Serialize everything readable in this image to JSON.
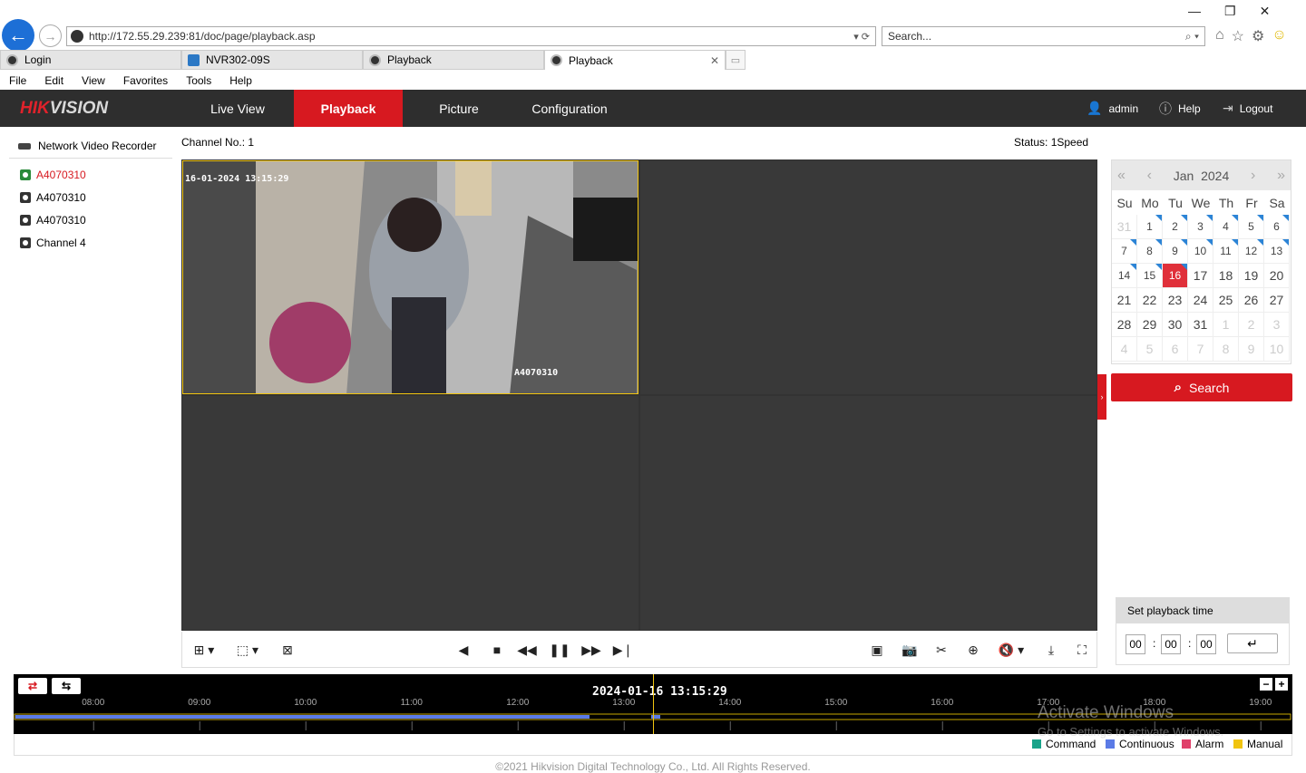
{
  "browser": {
    "url": "http://172.55.29.239:81/doc/page/playback.asp",
    "search_placeholder": "Search...",
    "tabs": [
      {
        "label": "Login"
      },
      {
        "label": "NVR302-09S"
      },
      {
        "label": "Playback"
      },
      {
        "label": "Playback"
      }
    ],
    "menu": [
      "File",
      "Edit",
      "View",
      "Favorites",
      "Tools",
      "Help"
    ]
  },
  "app": {
    "logo_a": "HIK",
    "logo_b": "VISION",
    "nav": [
      "Live View",
      "Playback",
      "Picture",
      "Configuration"
    ],
    "active_nav": "Playback",
    "user": "admin",
    "help": "Help",
    "logout": "Logout",
    "colors": {
      "brand": "#d71920",
      "header": "#2e2e2e"
    }
  },
  "left_panel": {
    "title": "Network Video Recorder",
    "channels": [
      {
        "label": "A4070310",
        "active": true
      },
      {
        "label": "A4070310",
        "active": false
      },
      {
        "label": "A4070310",
        "active": false
      },
      {
        "label": "Channel 4",
        "active": false
      }
    ]
  },
  "playback": {
    "channel_label": "Channel No.: 1",
    "status_label": "Status: 1Speed",
    "osd_time": "16-01-2024 13:15:29",
    "osd_name": "A4070310"
  },
  "calendar": {
    "month": "Jan",
    "year": "2024",
    "dow": [
      "Su",
      "Mo",
      "Tu",
      "We",
      "Th",
      "Fr",
      "Sa"
    ],
    "weeks": [
      [
        "31",
        "1",
        "2",
        "3",
        "4",
        "5",
        "6"
      ],
      [
        "7",
        "8",
        "9",
        "10",
        "11",
        "12",
        "13"
      ],
      [
        "14",
        "15",
        "16",
        "17",
        "18",
        "19",
        "20"
      ],
      [
        "21",
        "22",
        "23",
        "24",
        "25",
        "26",
        "27"
      ],
      [
        "28",
        "29",
        "30",
        "31",
        "1",
        "2",
        "3"
      ],
      [
        "4",
        "5",
        "6",
        "7",
        "8",
        "9",
        "10"
      ]
    ],
    "selected": "16"
  },
  "search_label": "Search",
  "set_time": {
    "title": "Set playback time",
    "hh": "00",
    "mm": "00",
    "ss": "00"
  },
  "timeline": {
    "current": "2024-01-16 13:15:29",
    "ticks": [
      "08:00",
      "09:00",
      "10:00",
      "11:00",
      "12:00",
      "13:00",
      "14:00",
      "15:00",
      "16:00",
      "17:00",
      "18:00",
      "19:00"
    ],
    "record_range": [
      "08:00",
      "13:15"
    ]
  },
  "legend": [
    {
      "label": "Command",
      "color": "#1aa38a"
    },
    {
      "label": "Continuous",
      "color": "#5b7be6"
    },
    {
      "label": "Alarm",
      "color": "#e0406a"
    },
    {
      "label": "Manual",
      "color": "#f1c40f"
    }
  ],
  "watermark": {
    "line1": "Activate Windows",
    "line2": "Go to Settings to activate Windows."
  },
  "footer": "©2021 Hikvision Digital Technology Co., Ltd. All Rights Reserved."
}
